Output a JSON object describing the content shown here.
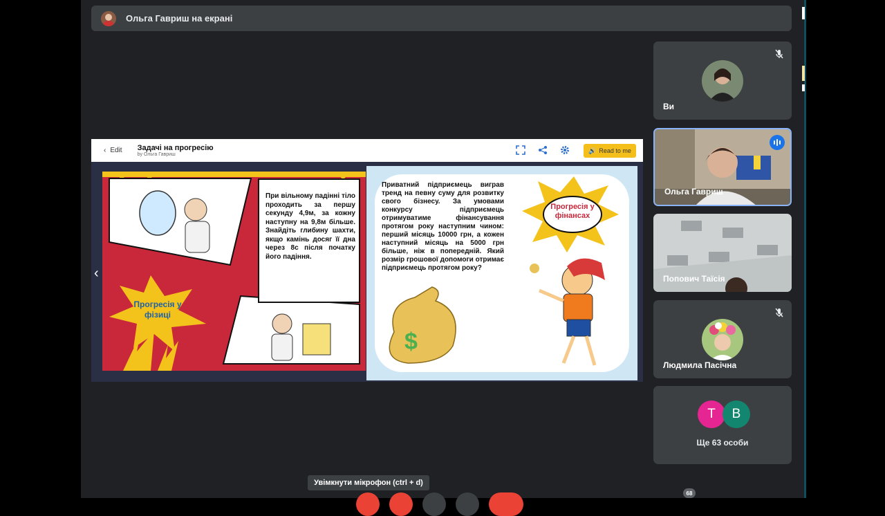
{
  "presenter": {
    "text": "Ольга Гавриш на екрані"
  },
  "doc": {
    "edit_label": "Edit",
    "title": "Задачі на прогресію",
    "author": "by Ольга Гавриш",
    "read_label": "Read to me"
  },
  "left_page": {
    "problem": "При вільному падінні тіло проходить за першу секунду 4,9м, за кожну наступну на 9,8м більше. Знайдіть глибину шахти, якщо камінь досяг її дна через 8с після початку його падіння.",
    "burst": "Прогресія у фізиці"
  },
  "right_page": {
    "problem": "Приватний підприємець виграв тренд на певну суму для розвитку свого бізнесу. За умовами конкурсу підприємець отримуватиме фінансування протягом року наступним чином: перший місяць 10000 грн, а кожен наступний місяць на 5000 грн більше, ніж в попередній. Який розмір грошової допомоги отримає підприємець протягом року?",
    "burst": "Прогресія у фінансах"
  },
  "participants": [
    {
      "name": "Ви",
      "muted": true
    },
    {
      "name": "Ольга Гавриш",
      "speaking": true
    },
    {
      "name": "Попович Таїсія"
    },
    {
      "name": "Людмила Пасічна",
      "muted": true
    }
  ],
  "more": {
    "initials": [
      "Т",
      "В"
    ],
    "colors": [
      "#e52592",
      "#12866f"
    ],
    "label": "Ще 63 особи"
  },
  "tooltip": "Увімкнути мікрофон (ctrl + d)",
  "badge_count": "68"
}
